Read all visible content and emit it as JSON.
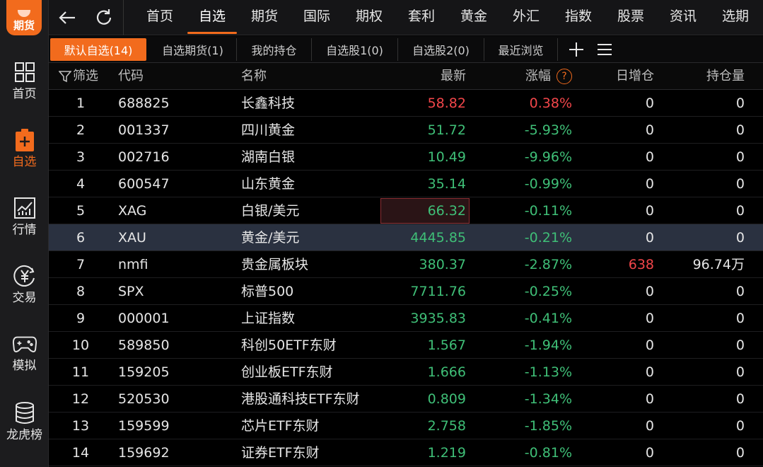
{
  "sidebar": {
    "logo_text": "期货",
    "items": [
      {
        "label": "首页",
        "icon": "grid-icon"
      },
      {
        "label": "自选",
        "icon": "clipboard-plus-icon"
      },
      {
        "label": "行情",
        "icon": "chart-icon"
      },
      {
        "label": "交易",
        "icon": "yuan-icon"
      },
      {
        "label": "模拟",
        "icon": "gamepad-icon"
      },
      {
        "label": "龙虎榜",
        "icon": "database-icon"
      }
    ]
  },
  "topbar": {
    "menu": [
      "首页",
      "自选",
      "期货",
      "国际",
      "期权",
      "套利",
      "黄金",
      "外汇",
      "指数",
      "股票",
      "资讯",
      "选期"
    ],
    "active": "自选"
  },
  "tabs": [
    "默认自选(14)",
    "自选期货(1)",
    "我的持仓",
    "自选股1(0)",
    "自选股2(0)",
    "最近浏览"
  ],
  "table": {
    "headers": {
      "filter": "筛选",
      "code": "代码",
      "name": "名称",
      "price": "最新",
      "change": "涨幅",
      "daily_oi": "日增仓",
      "oi": "持仓量"
    },
    "rows": [
      {
        "idx": "1",
        "code": "688825",
        "name": "长鑫科技",
        "price": "58.82",
        "change": "0.38%",
        "daily_oi": "0",
        "oi": "0",
        "dir": "up"
      },
      {
        "idx": "2",
        "code": "001337",
        "name": "四川黄金",
        "price": "51.72",
        "change": "-5.93%",
        "daily_oi": "0",
        "oi": "0",
        "dir": "down"
      },
      {
        "idx": "3",
        "code": "002716",
        "name": "湖南白银",
        "price": "10.49",
        "change": "-9.96%",
        "daily_oi": "0",
        "oi": "0",
        "dir": "down"
      },
      {
        "idx": "4",
        "code": "600547",
        "name": "山东黄金",
        "price": "35.14",
        "change": "-0.99%",
        "daily_oi": "0",
        "oi": "0",
        "dir": "down"
      },
      {
        "idx": "5",
        "code": "XAG",
        "name": "白银/美元",
        "price": "66.32",
        "change": "-0.11%",
        "daily_oi": "0",
        "oi": "0",
        "dir": "down"
      },
      {
        "idx": "6",
        "code": "XAU",
        "name": "黄金/美元",
        "price": "4445.85",
        "change": "-0.21%",
        "daily_oi": "0",
        "oi": "0",
        "dir": "down"
      },
      {
        "idx": "7",
        "code": "nmfi",
        "name": "贵金属板块",
        "price": "380.37",
        "change": "-2.87%",
        "daily_oi": "638",
        "oi": "96.74万",
        "dir": "down"
      },
      {
        "idx": "8",
        "code": "SPX",
        "name": "标普500",
        "price": "7711.76",
        "change": "-0.25%",
        "daily_oi": "0",
        "oi": "0",
        "dir": "down"
      },
      {
        "idx": "9",
        "code": "000001",
        "name": "上证指数",
        "price": "3935.83",
        "change": "-0.41%",
        "daily_oi": "0",
        "oi": "0",
        "dir": "down"
      },
      {
        "idx": "10",
        "code": "589850",
        "name": "科创50ETF东财",
        "price": "1.567",
        "change": "-1.94%",
        "daily_oi": "0",
        "oi": "0",
        "dir": "down"
      },
      {
        "idx": "11",
        "code": "159205",
        "name": "创业板ETF东财",
        "price": "1.666",
        "change": "-1.13%",
        "daily_oi": "0",
        "oi": "0",
        "dir": "down"
      },
      {
        "idx": "12",
        "code": "520530",
        "name": "港股通科技ETF东财",
        "price": "0.809",
        "change": "-1.34%",
        "daily_oi": "0",
        "oi": "0",
        "dir": "down"
      },
      {
        "idx": "13",
        "code": "159599",
        "name": "芯片ETF东财",
        "price": "2.758",
        "change": "-1.85%",
        "daily_oi": "0",
        "oi": "0",
        "dir": "down"
      },
      {
        "idx": "14",
        "code": "159692",
        "name": "证券ETF东财",
        "price": "1.219",
        "change": "-0.81%",
        "daily_oi": "0",
        "oi": "0",
        "dir": "down"
      }
    ]
  },
  "colors": {
    "accent": "#f26b1d",
    "up": "#f2464a",
    "down": "#3fbf77",
    "selected_row": "#2a3140"
  }
}
